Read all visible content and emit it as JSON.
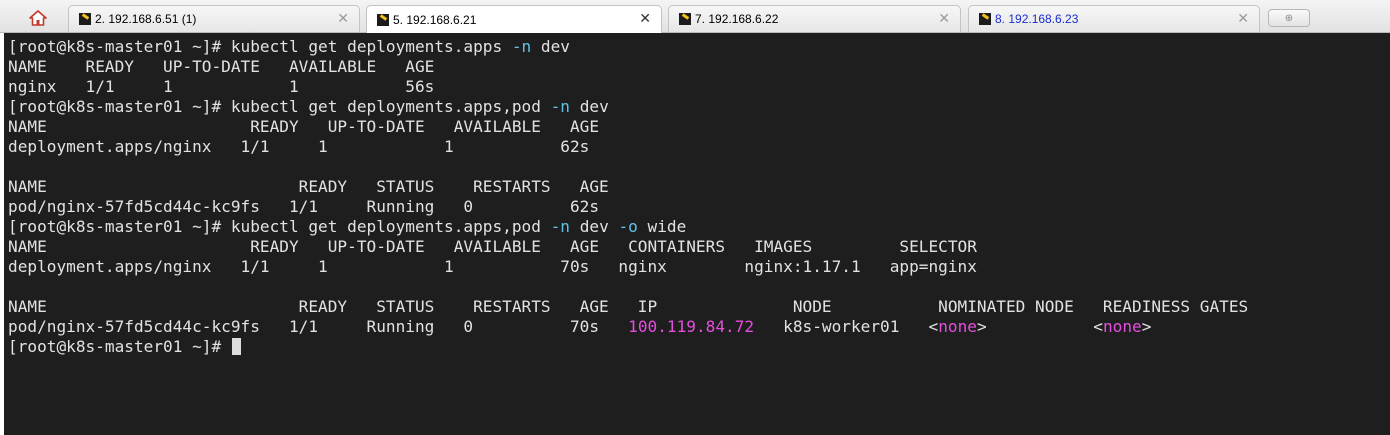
{
  "tabs": [
    {
      "label": "2. 192.168.6.51 (1)",
      "active": false
    },
    {
      "label": "5. 192.168.6.21",
      "active": true
    },
    {
      "label": "7. 192.168.6.22",
      "active": false
    },
    {
      "label": "8. 192.168.6.23",
      "active": false
    }
  ],
  "terminal": {
    "lines": [
      [
        {
          "t": "[root@k8s-master01 ~]# kubectl get deployments.apps "
        },
        {
          "t": "-n",
          "c": "blue"
        },
        {
          "t": " dev"
        }
      ],
      [
        {
          "t": "NAME    READY   UP-TO-DATE   AVAILABLE   AGE"
        }
      ],
      [
        {
          "t": "nginx   1/1     1            1           56s"
        }
      ],
      [
        {
          "t": "[root@k8s-master01 ~]# kubectl get deployments.apps,pod "
        },
        {
          "t": "-n",
          "c": "blue"
        },
        {
          "t": " dev"
        }
      ],
      [
        {
          "t": "NAME                     READY   UP-TO-DATE   AVAILABLE   AGE"
        }
      ],
      [
        {
          "t": "deployment.apps/nginx   1/1     1            1           62s"
        }
      ],
      [
        {
          "t": ""
        }
      ],
      [
        {
          "t": "NAME                          READY   STATUS    RESTARTS   AGE"
        }
      ],
      [
        {
          "t": "pod/nginx-57fd5cd44c-kc9fs   1/1     Running   0          62s"
        }
      ],
      [
        {
          "t": "[root@k8s-master01 ~]# kubectl get deployments.apps,pod "
        },
        {
          "t": "-n",
          "c": "blue"
        },
        {
          "t": " dev "
        },
        {
          "t": "-o",
          "c": "blue"
        },
        {
          "t": " wide"
        }
      ],
      [
        {
          "t": "NAME                     READY   UP-TO-DATE   AVAILABLE   AGE   CONTAINERS   IMAGES         SELECTOR"
        }
      ],
      [
        {
          "t": "deployment.apps/nginx   1/1     1            1           70s   nginx        nginx:1.17.1   app=nginx"
        }
      ],
      [
        {
          "t": ""
        }
      ],
      [
        {
          "t": "NAME                          READY   STATUS    RESTARTS   AGE   IP              NODE           NOMINATED NODE   READINESS GATES"
        }
      ],
      [
        {
          "t": "pod/nginx-57fd5cd44c-kc9fs   1/1     Running   0          70s   "
        },
        {
          "t": "100.119.84.72",
          "c": "pink"
        },
        {
          "t": "   k8s-worker01   <"
        },
        {
          "t": "none",
          "c": "pink"
        },
        {
          "t": ">           <"
        },
        {
          "t": "none",
          "c": "pink"
        },
        {
          "t": ">"
        }
      ],
      [
        {
          "t": "[root@k8s-master01 ~]# "
        }
      ]
    ]
  }
}
